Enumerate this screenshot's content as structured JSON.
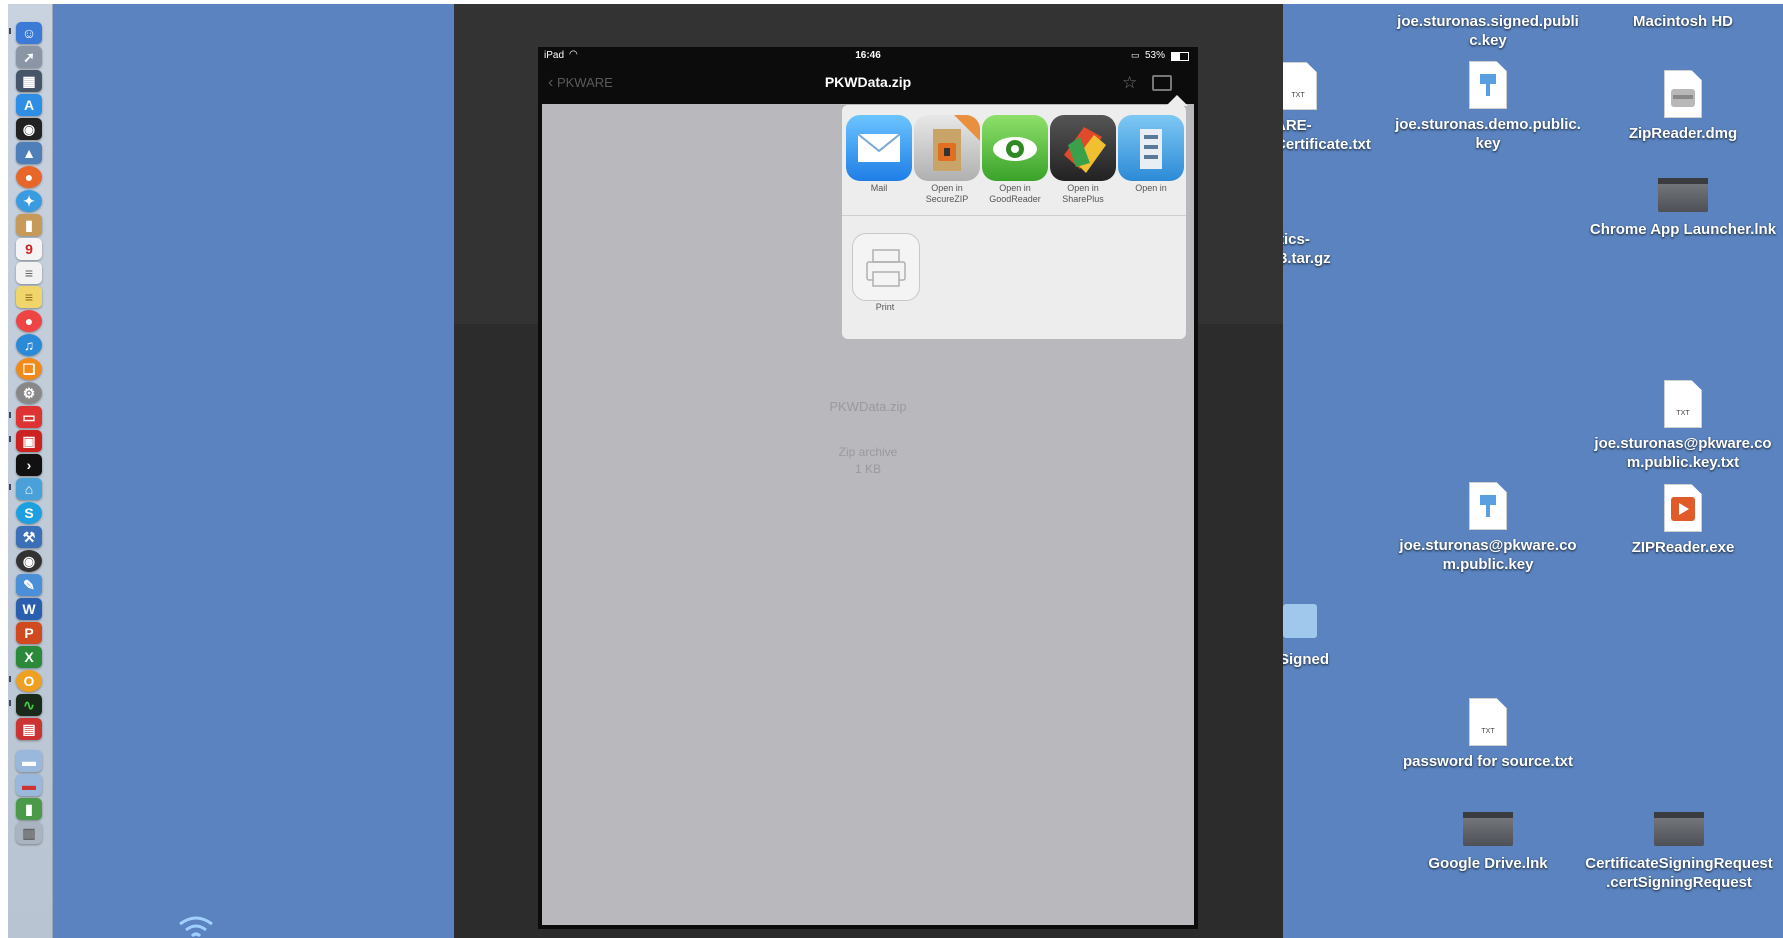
{
  "ipad": {
    "status_left": "iPad",
    "time": "16:46",
    "battery": "53%",
    "nav_back": "PKWARE",
    "nav_title": "PKWData.zip",
    "file_name": "PKWData.zip",
    "file_type": "Zip archive",
    "file_size": "1 KB"
  },
  "share": {
    "items": [
      {
        "label_1": "Mail",
        "label_2": ""
      },
      {
        "label_1": "Open in",
        "label_2": "SecureZIP"
      },
      {
        "label_1": "Open in",
        "label_2": "GoodReader"
      },
      {
        "label_1": "Open in",
        "label_2": "SharePlus"
      },
      {
        "label_1": "Open in",
        "label_2": ""
      }
    ],
    "print_label": "Print"
  },
  "desktop": {
    "signed_key": [
      "joe.sturonas.signed.publi",
      "c.key"
    ],
    "macintosh_hd": "Macintosh HD",
    "pkware_cert": [
      "ARE-",
      "Certificate.txt"
    ],
    "demo_key": [
      "joe.sturonas.demo.public.",
      "key"
    ],
    "zipreader_dmg": "ZipReader.dmg",
    "chrome_launcher": "Chrome App Launcher.lnk",
    "tar_gz": [
      "tics-",
      "3.tar.gz"
    ],
    "pkware_public_txt": [
      "joe.sturonas@pkware.co",
      "m.public.key.txt"
    ],
    "pkware_public_key": [
      "joe.sturonas@pkware.co",
      "m.public.key"
    ],
    "zipreader_exe": "ZIPReader.exe",
    "signed_folder": "Signed",
    "password_txt": "password for source.txt",
    "google_drive": "Google Drive.lnk",
    "csr": [
      "CertificateSigningRequest",
      ".certSigningRequest"
    ],
    "txt_tag": "TXT"
  },
  "colors": {
    "desktop_blue": "#5a83bf",
    "ipad_gray": "#b9b8bc",
    "popover": "#ededed"
  }
}
